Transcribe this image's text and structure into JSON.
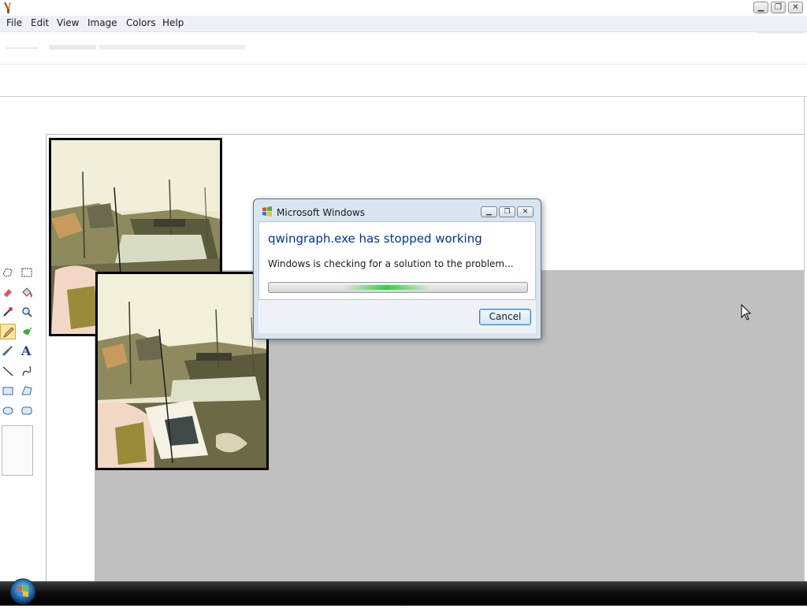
{
  "app": {
    "icon": "paint-icon",
    "window_buttons": [
      "minimize",
      "restore",
      "close"
    ],
    "window_button_glyphs": [
      "▁",
      "❐",
      "✕"
    ]
  },
  "menubar": {
    "items": [
      {
        "label": "File"
      },
      {
        "label": "Edit"
      },
      {
        "label": "View"
      },
      {
        "label": "Image"
      },
      {
        "label": "Colors"
      },
      {
        "label": "Help"
      }
    ]
  },
  "tools": [
    {
      "name": "free-form-select-icon"
    },
    {
      "name": "rect-select-icon"
    },
    {
      "name": "eraser-icon"
    },
    {
      "name": "fill-bucket-icon"
    },
    {
      "name": "color-picker-icon"
    },
    {
      "name": "magnifier-icon"
    },
    {
      "name": "pencil-icon",
      "selected": true
    },
    {
      "name": "airbrush-icon"
    },
    {
      "name": "brush-icon"
    },
    {
      "name": "text-icon",
      "glyph": "A"
    },
    {
      "name": "line-icon"
    },
    {
      "name": "curve-icon"
    },
    {
      "name": "rectangle-icon"
    },
    {
      "name": "polygon-icon"
    },
    {
      "name": "ellipse-icon"
    },
    {
      "name": "rounded-rect-icon"
    }
  ],
  "dialog": {
    "title": "Microsoft Windows",
    "heading": "qwingraph.exe has stopped working",
    "message": "Windows is checking for a solution to the problem...",
    "cancel_label": "Cancel",
    "buttons": [
      "minimize",
      "restore",
      "close"
    ],
    "button_glyphs": [
      "▁",
      "❐",
      "✕"
    ],
    "progress_style": "indeterminate",
    "progress_color": "#2fd13a"
  },
  "taskbar": {
    "start_icon": "windows-start-orb-icon"
  },
  "colors": {
    "menubar_bg": "#eef0f7",
    "gray_workspace": "#c0c0c0",
    "dialog_heading": "#003399",
    "taskbar": "#000000"
  }
}
